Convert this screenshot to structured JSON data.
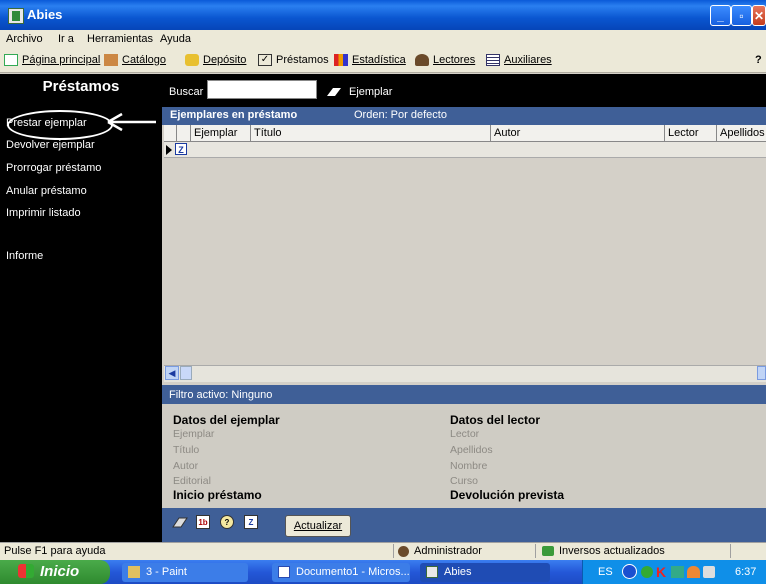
{
  "window": {
    "title": "Abies"
  },
  "menubar": {
    "items": [
      "Archivo",
      "Ir a",
      "Herramientas",
      "Ayuda"
    ]
  },
  "toolbar": {
    "items": [
      {
        "label": "Página principal",
        "icon": "home-icon"
      },
      {
        "label": "Catálogo",
        "icon": "catalog-icon"
      },
      {
        "label": "Depósito",
        "icon": "deposit-icon"
      },
      {
        "label": "Préstamos",
        "icon": "loans-icon"
      },
      {
        "label": "Estadística",
        "icon": "statistics-icon"
      },
      {
        "label": "Lectores",
        "icon": "readers-icon"
      },
      {
        "label": "Auxiliares",
        "icon": "auxiliary-icon"
      }
    ],
    "help": "?"
  },
  "sidebar": {
    "title": "Préstamos",
    "items": [
      {
        "label": "Prestar ejemplar"
      },
      {
        "label": "Devolver ejemplar"
      },
      {
        "label": "Prorrogar préstamo"
      },
      {
        "label": "Anular préstamo"
      },
      {
        "label": "Imprimir listado"
      },
      {
        "label": "Informe"
      }
    ]
  },
  "search": {
    "label": "Buscar",
    "value": "",
    "mode": "Ejemplar"
  },
  "grid": {
    "title": "Ejemplares en préstamo",
    "order": "Orden: Por defecto",
    "columns": [
      "Ejemplar",
      "Título",
      "Autor",
      "Lector",
      "Apellidos"
    ]
  },
  "filter": {
    "text": "Filtro activo: Ninguno"
  },
  "details": {
    "copy_title": "Datos del ejemplar",
    "copy_fields": [
      "Ejemplar",
      "Título",
      "Autor",
      "Editorial"
    ],
    "start_label": "Inicio préstamo",
    "reader_title": "Datos del lector",
    "reader_fields": [
      "Lector",
      "Apellidos",
      "Nombre",
      "Curso"
    ],
    "due_label": "Devolución prevista"
  },
  "bottom": {
    "refresh_label": "Actualizar",
    "icon_labels": [
      "1b",
      "?",
      "Z"
    ]
  },
  "statusbar": {
    "hint": "Pulse F1 para ayuda",
    "user": "Administrador",
    "sync": "Inversos actualizados"
  },
  "taskbar": {
    "start": "Inicio",
    "tasks": [
      "3 - Paint",
      "Documento1 - Micros...",
      "Abies"
    ],
    "lang": "ES",
    "time": "6:37"
  },
  "colors": {
    "title_blue": "#0a56d0",
    "panel_blue": "#3f5f97",
    "sidebar_black": "#000000"
  }
}
